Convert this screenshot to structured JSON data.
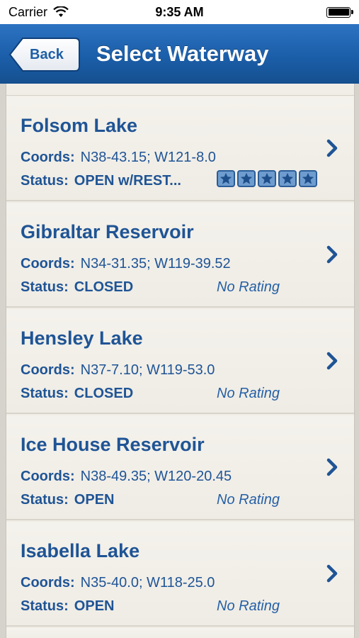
{
  "status_bar": {
    "carrier": "Carrier",
    "time": "9:35 AM"
  },
  "nav": {
    "back_label": "Back",
    "title": "Select Waterway"
  },
  "labels": {
    "coords": "Coords:",
    "status": "Status:"
  },
  "rows": [
    {
      "name": "Folsom Lake",
      "coords": "N38-43.15; W121-8.0",
      "status": "OPEN w/REST...",
      "rating": "",
      "stars": 5
    },
    {
      "name": "Gibraltar Reservoir",
      "coords": "N34-31.35; W119-39.52",
      "status": "CLOSED",
      "rating": "No Rating"
    },
    {
      "name": "Hensley Lake",
      "coords": "N37-7.10; W119-53.0",
      "status": "CLOSED",
      "rating": "No Rating"
    },
    {
      "name": "Ice House Reservoir",
      "coords": "N38-49.35; W120-20.45",
      "status": "OPEN",
      "rating": "No Rating"
    },
    {
      "name": "Isabella Lake",
      "coords": "N35-40.0; W118-25.0",
      "status": "OPEN",
      "rating": "No Rating"
    }
  ],
  "colors": {
    "nav_bg": "#1b5ea9",
    "text_blue": "#1f5495",
    "row_bg": "#efece5"
  }
}
